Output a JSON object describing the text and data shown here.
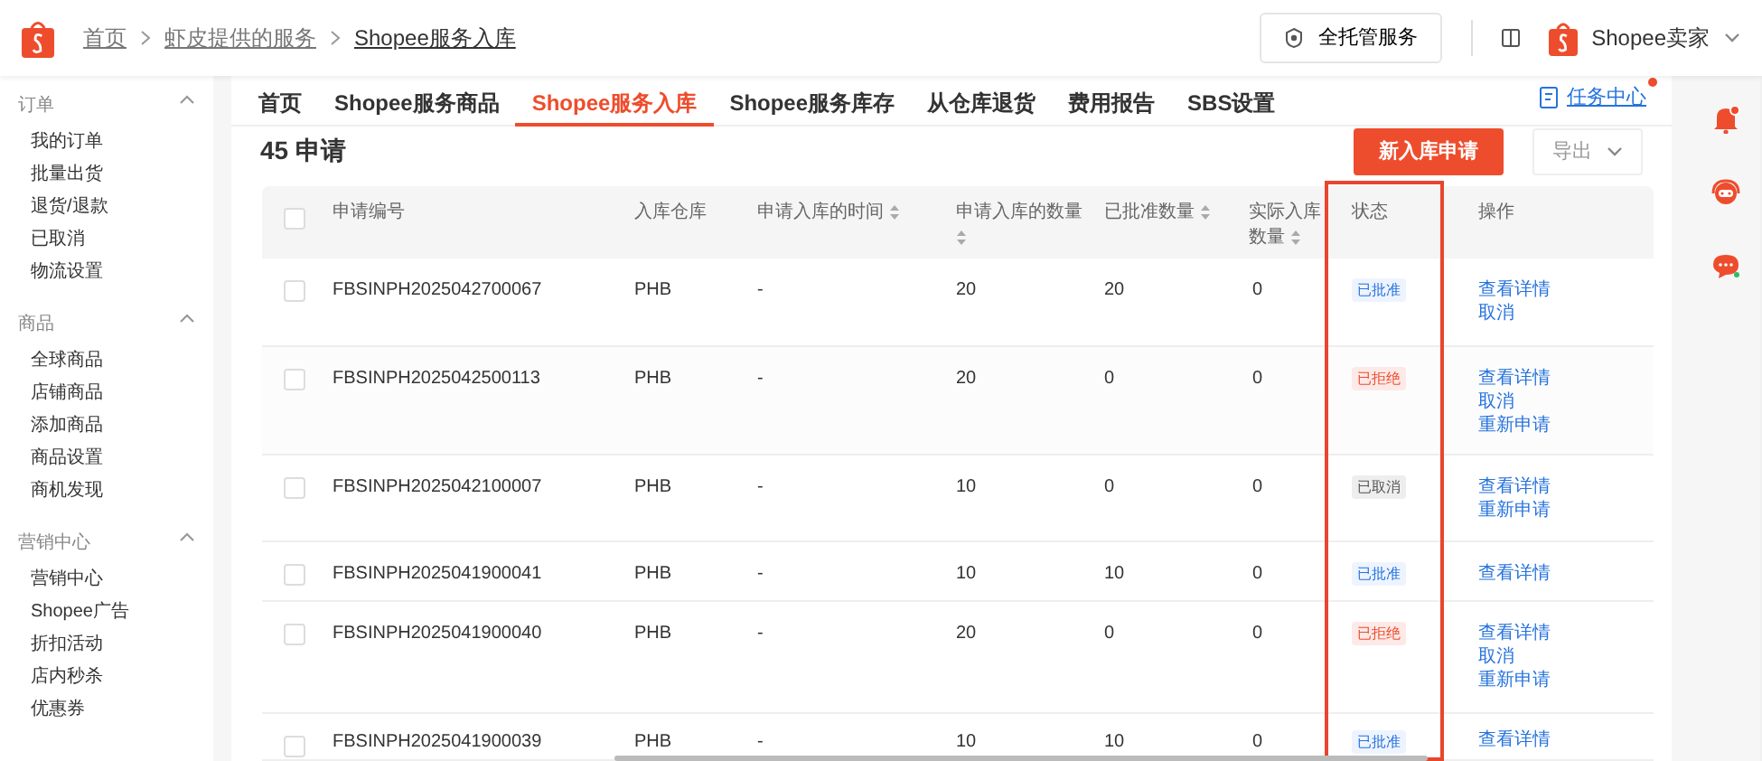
{
  "header": {
    "breadcrumbs": [
      "首页",
      "虾皮提供的服务",
      "Shopee服务入库"
    ],
    "managed_service_button": "全托管服务",
    "seller_name": "Shopee卖家"
  },
  "sidebar": [
    {
      "title": "订单",
      "expanded": true,
      "items": [
        "我的订单",
        "批量出货",
        "退货/退款",
        "已取消",
        "物流设置"
      ]
    },
    {
      "title": "商品",
      "expanded": true,
      "items": [
        "全球商品",
        "店铺商品",
        "添加商品",
        "商品设置",
        "商机发现"
      ]
    },
    {
      "title": "营销中心",
      "expanded": true,
      "items": [
        "营销中心",
        "Shopee广告",
        "折扣活动",
        "店内秒杀",
        "优惠券"
      ]
    }
  ],
  "tabs": [
    {
      "label": "首页",
      "selected": false
    },
    {
      "label": "Shopee服务商品",
      "selected": false
    },
    {
      "label": "Shopee服务入库",
      "selected": true
    },
    {
      "label": "Shopee服务库存",
      "selected": false
    },
    {
      "label": "从仓库退货",
      "selected": false
    },
    {
      "label": "费用报告",
      "selected": false
    },
    {
      "label": "SBS设置",
      "selected": false
    }
  ],
  "task_center": {
    "label": "任务中心",
    "has_notification": true
  },
  "count_title": "45 申请",
  "new_request_button": "新入库申请",
  "export_button": "导出",
  "table": {
    "select_all_checked": false,
    "columns": [
      {
        "label": "申请编号",
        "sortable": false
      },
      {
        "label": "入库仓库",
        "sortable": false
      },
      {
        "label": "申请入库的时间",
        "sortable": true
      },
      {
        "label": "申请入库的数量",
        "sortable": true
      },
      {
        "label": "已批准数量",
        "sortable": true
      },
      {
        "label": "实际入库数量",
        "sortable": true
      },
      {
        "label": "状态",
        "sortable": false
      },
      {
        "label": "操作",
        "sortable": false
      }
    ],
    "rows": [
      {
        "checked": false,
        "id": "FBSINPH2025042700067",
        "warehouse": "PHB",
        "time": "-",
        "requested": "20",
        "approved": "20",
        "actual": "0",
        "status": {
          "label": "已批准",
          "kind": "approved"
        },
        "actions": [
          "查看详情",
          "取消"
        ]
      },
      {
        "checked": false,
        "id": "FBSINPH2025042500113",
        "warehouse": "PHB",
        "time": "-",
        "requested": "20",
        "approved": "0",
        "actual": "0",
        "status": {
          "label": "已拒绝",
          "kind": "rejected"
        },
        "actions": [
          "查看详情",
          "取消",
          "重新申请"
        ]
      },
      {
        "checked": false,
        "id": "FBSINPH2025042100007",
        "warehouse": "PHB",
        "time": "-",
        "requested": "10",
        "approved": "0",
        "actual": "0",
        "status": {
          "label": "已取消",
          "kind": "cancelled"
        },
        "actions": [
          "查看详情",
          "重新申请"
        ]
      },
      {
        "checked": false,
        "id": "FBSINPH2025041900041",
        "warehouse": "PHB",
        "time": "-",
        "requested": "10",
        "approved": "10",
        "actual": "0",
        "status": {
          "label": "已批准",
          "kind": "approved"
        },
        "actions": [
          "查看详情"
        ]
      },
      {
        "checked": false,
        "id": "FBSINPH2025041900040",
        "warehouse": "PHB",
        "time": "-",
        "requested": "20",
        "approved": "0",
        "actual": "0",
        "status": {
          "label": "已拒绝",
          "kind": "rejected"
        },
        "actions": [
          "查看详情",
          "取消",
          "重新申请"
        ]
      },
      {
        "checked": false,
        "id": "FBSINPH2025041900039",
        "warehouse": "PHB",
        "time": "-",
        "requested": "10",
        "approved": "10",
        "actual": "0",
        "status": {
          "label": "已批准",
          "kind": "approved"
        },
        "actions": [
          "查看详情"
        ]
      }
    ]
  },
  "right_rail": {
    "bell_notification": true
  }
}
